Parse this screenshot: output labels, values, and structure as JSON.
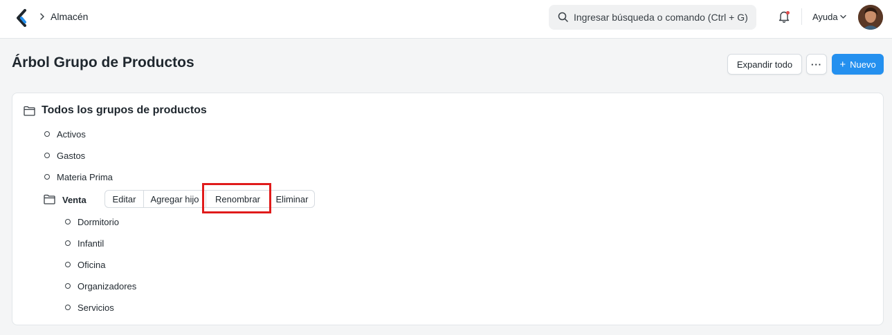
{
  "navbar": {
    "breadcrumb": "Almacén",
    "search_placeholder": "Ingresar búsqueda o comando (Ctrl + G)",
    "help_label": "Ayuda"
  },
  "page": {
    "title": "Árbol Grupo de Productos",
    "expand_all_label": "Expandir todo",
    "more_label": "···",
    "new_plus": "+",
    "new_label": "Nuevo"
  },
  "tree": {
    "root_label": "Todos los grupos de productos",
    "top_items": [
      "Activos",
      "Gastos",
      "Materia Prima"
    ],
    "venta": {
      "label": "Venta",
      "actions": {
        "edit": "Editar",
        "add_child": "Agregar hijo",
        "rename": "Renombrar",
        "delete": "Eliminar"
      },
      "children": [
        "Dormitorio",
        "Infantil",
        "Oficina",
        "Organizadores",
        "Servicios"
      ]
    }
  },
  "colors": {
    "primary": "#2490ef",
    "highlight": "#e01b1b",
    "notification_dot": "#e24c4c"
  }
}
